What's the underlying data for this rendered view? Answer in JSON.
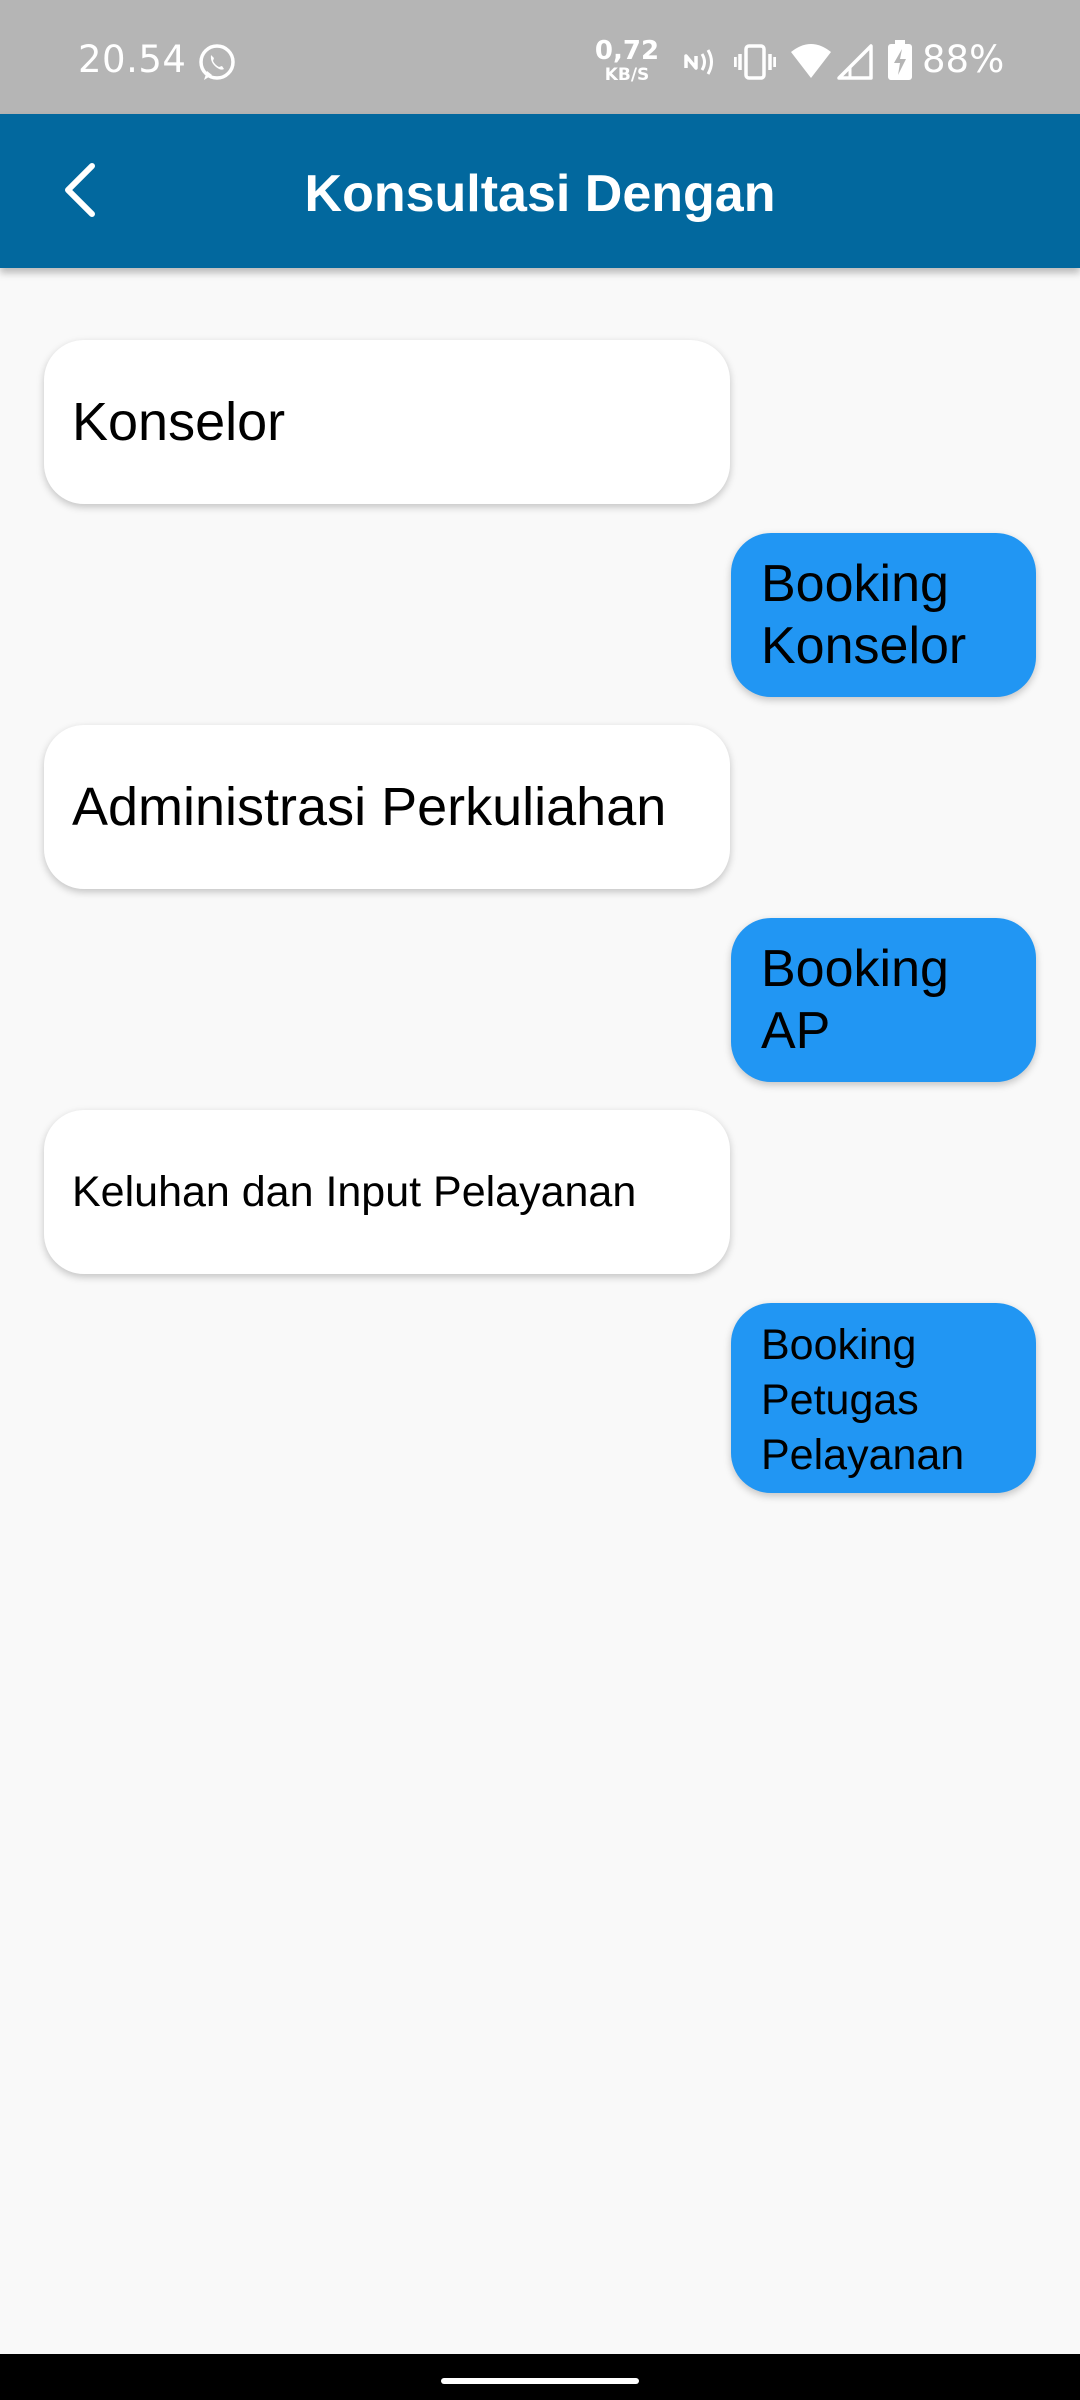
{
  "status_bar": {
    "time": "20.54",
    "net_speed_value": "0,72",
    "net_speed_unit": "KB/S",
    "battery_percent": "88%",
    "icons": [
      "whatsapp-icon",
      "nfc-icon",
      "vibrate-icon",
      "wifi-icon",
      "signal-icon",
      "battery-charging-icon"
    ]
  },
  "app_bar": {
    "title": "Konsultasi Dengan",
    "back_icon": "chevron-left-icon",
    "color": "#02689e"
  },
  "options": [
    {
      "category": "Konselor",
      "booking_label": "Booking Konselor"
    },
    {
      "category": "Administrasi Perkuliahan",
      "booking_label": "Booking AP"
    },
    {
      "category": "Keluhan dan Input Pelayanan",
      "booking_label": "Booking Petugas Pelayanan"
    }
  ],
  "colors": {
    "booking_button": "#2196f3",
    "background": "#f9f9f9",
    "status_bar": "#b5b5b5"
  }
}
